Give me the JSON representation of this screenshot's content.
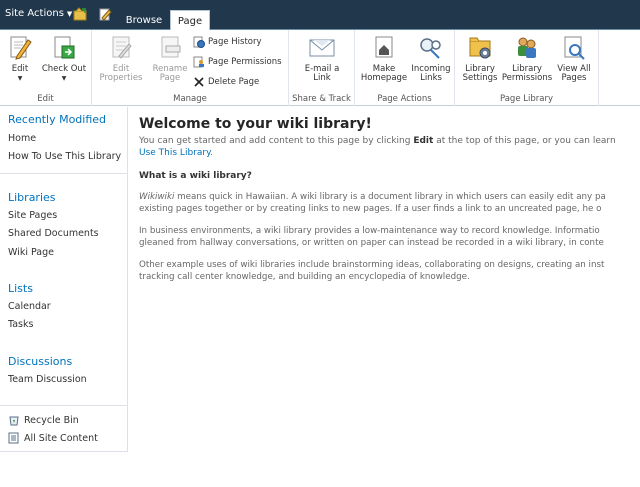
{
  "top_bar": {
    "site_actions": "Site Actions",
    "tabs": [
      "Browse",
      "Page"
    ],
    "active_tab": "Page"
  },
  "ribbon": {
    "edit_group": {
      "label": "Edit",
      "edit": "Edit",
      "check_out": "Check Out"
    },
    "manage_group": {
      "label": "Manage",
      "edit_properties": "Edit\nProperties",
      "rename_page": "Rename\nPage",
      "page_history": "Page History",
      "page_permissions": "Page Permissions",
      "delete_page": "Delete Page"
    },
    "share_group": {
      "label": "Share & Track",
      "email_link": "E-mail a\nLink"
    },
    "page_actions_group": {
      "label": "Page Actions",
      "make_homepage": "Make\nHomepage",
      "incoming_links": "Incoming\nLinks"
    },
    "library_group": {
      "label": "Page Library",
      "library_settings": "Library\nSettings",
      "library_permissions": "Library\nPermissions",
      "view_all_pages": "View All\nPages"
    }
  },
  "quick_launch": {
    "recently_modified": {
      "heading": "Recently Modified",
      "items": [
        "Home",
        "How To Use This Library"
      ]
    },
    "libraries": {
      "heading": "Libraries",
      "items": [
        "Site Pages",
        "Shared Documents",
        "Wiki Page"
      ]
    },
    "lists": {
      "heading": "Lists",
      "items": [
        "Calendar",
        "Tasks"
      ]
    },
    "discussions": {
      "heading": "Discussions",
      "items": [
        "Team Discussion"
      ]
    },
    "recycle_bin": "Recycle Bin",
    "all_site_content": "All Site Content"
  },
  "content": {
    "title": "Welcome to your wiki library!",
    "intro_before": "You can get started and add content to this page by clicking ",
    "intro_bold": "Edit",
    "intro_after": " at the top of this page, or you can learn",
    "intro_link": "Use This Library",
    "intro_end": ".",
    "subheading": "What is a wiki library?",
    "p1_italic": "Wikiwiki",
    "p1_line1": " means quick in Hawaiian. A wiki library is a document library in which users can easily edit any pa",
    "p1_line2": "existing pages together or by creating links to new pages. If a user finds a link to an uncreated page, he o",
    "p2_line1": "In business environments, a wiki library provides a low-maintenance way to record knowledge. Informatio",
    "p2_line2": "gleaned from hallway conversations, or written on paper can instead be recorded in a wiki library, in conte",
    "p3_line1": "Other example uses of wiki libraries include brainstorming ideas, collaborating on designs, creating an inst",
    "p3_line2": "tracking call center knowledge, and building an encyclopedia of knowledge."
  },
  "colors": {
    "top_bar": "#21374c",
    "link": "#0072bc",
    "text_gray": "#676767"
  }
}
